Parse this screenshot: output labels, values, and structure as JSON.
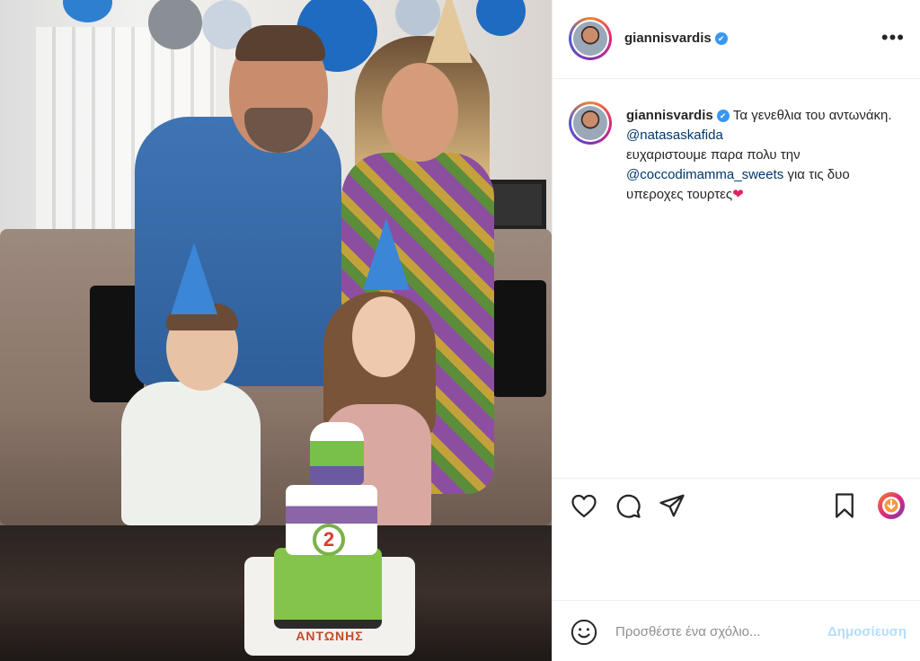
{
  "post": {
    "username": "giannisvardis",
    "verified_mark": "✔",
    "more_icon": "more-dots-icon",
    "more_label": "•••"
  },
  "photo": {
    "cake_number": "2",
    "cake_name": "ΑΝΤΩΝΗΣ"
  },
  "caption": {
    "username": "giannisvardis",
    "text_1": "Τα γενεθλια του αντωνάκη.",
    "mention_1": "@natasaskafida",
    "text_2": "ευχαριστουμε παρα πολυ την",
    "mention_2": "@coccodimamma_sweets",
    "text_3": "για τις δυο υπεροχες τουρτες",
    "emoji": "❤"
  },
  "actions": {
    "like_icon": "heart-icon",
    "comment_icon": "comment-icon",
    "share_icon": "share-icon",
    "save_icon": "bookmark-icon",
    "download_icon": "download-icon"
  },
  "comment": {
    "placeholder": "Προσθέστε ένα σχόλιο...",
    "post_label": "Δημοσίευση",
    "emoji_icon": "smiley-icon"
  },
  "colors": {
    "link": "#00376b",
    "verified": "#3897f0",
    "post_button": "#b2dffc",
    "heart": "#e0245e"
  }
}
